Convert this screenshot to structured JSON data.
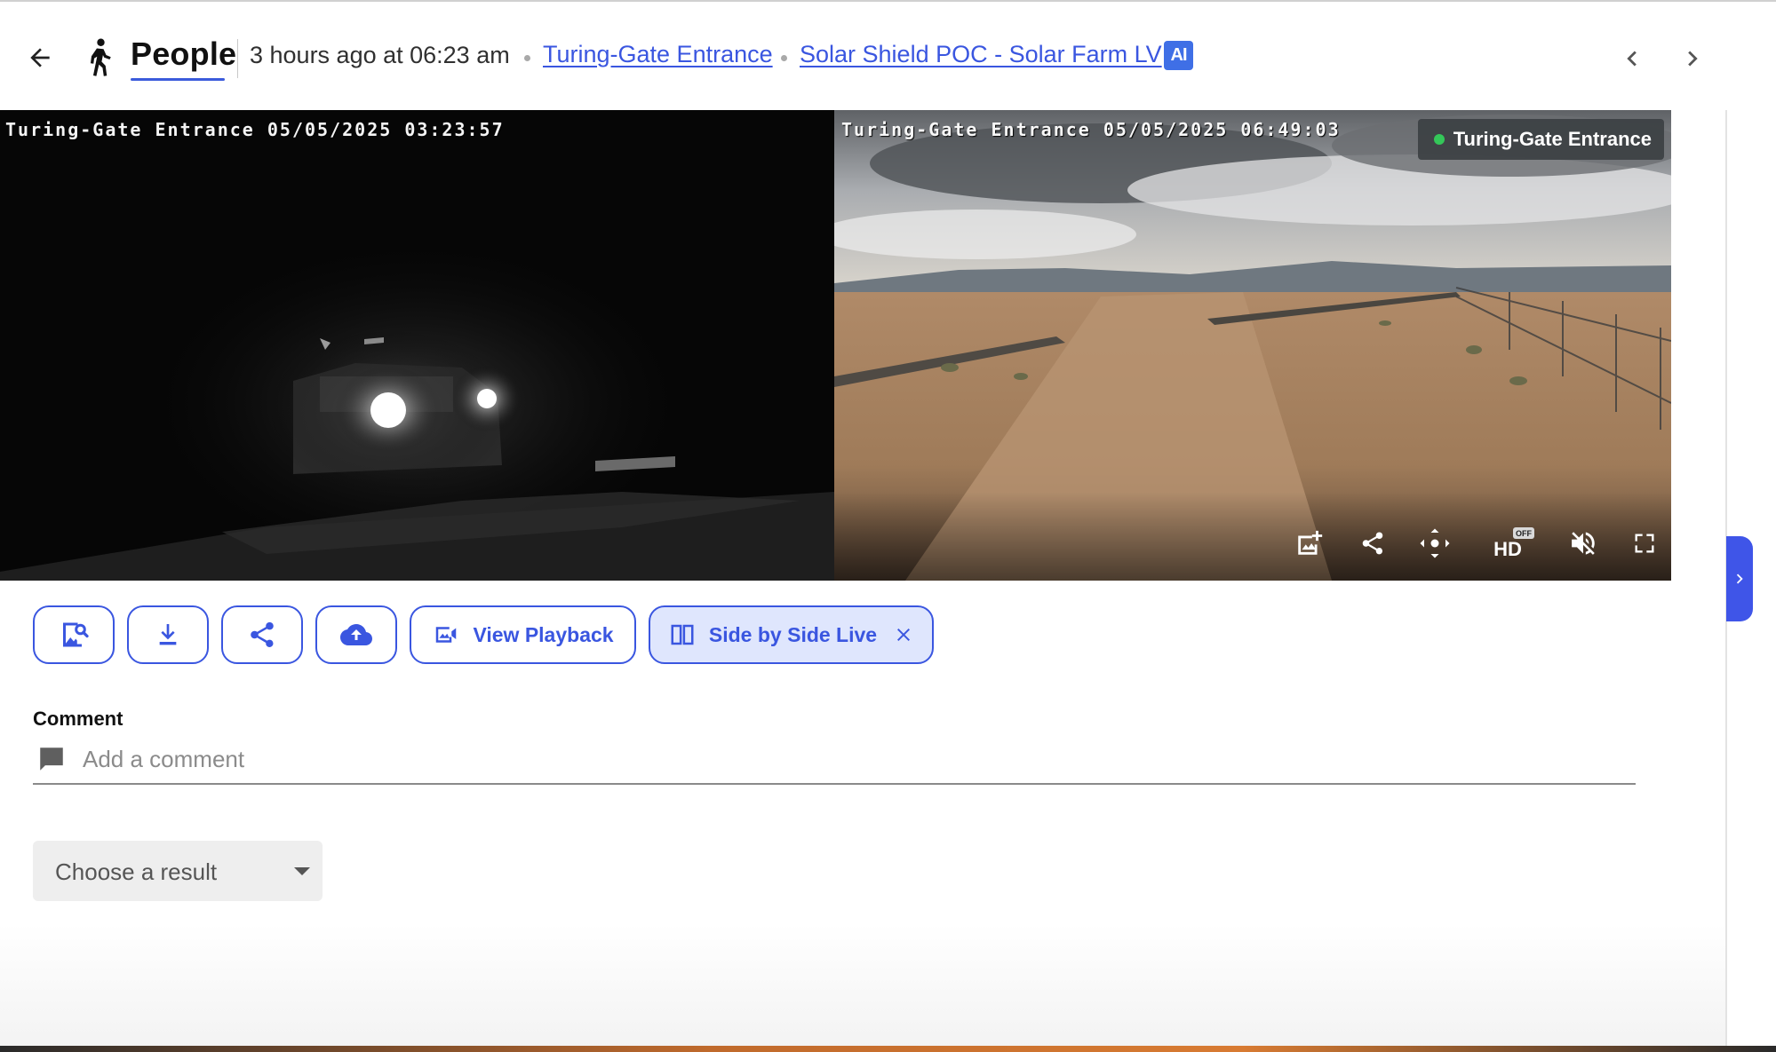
{
  "header": {
    "title": "People",
    "time_text": "3 hours ago at 06:23 am",
    "breadcrumbs": [
      "Turing-Gate Entrance",
      "Solar Shield POC - Solar Farm LV"
    ],
    "ai_badge": "AI",
    "icons": {
      "back": "arrow-left-icon",
      "category": "person-walking-icon",
      "prev": "chevron-left-icon",
      "next": "chevron-right-icon"
    }
  },
  "video": {
    "left_timestamp": "Turing-Gate Entrance 05/05/2025 03:23:57",
    "right_timestamp": "Turing-Gate Entrance 05/05/2025 06:49:03",
    "live_camera_label": "Turing-Gate Entrance",
    "hd_badge": "HD",
    "hd_state": "OFF",
    "controls": [
      "snapshot-icon",
      "share-icon",
      "ptz-move-icon",
      "hd-toggle-icon",
      "volume-off-icon",
      "fullscreen-icon"
    ]
  },
  "actions": {
    "icon_buttons": [
      "image-search-icon",
      "download-icon",
      "share-icon",
      "cloud-upload-icon"
    ],
    "view_playback": "View Playback",
    "side_by_side": "Side by Side Live"
  },
  "comment": {
    "label": "Comment",
    "placeholder": "Add a comment",
    "value": ""
  },
  "result": {
    "placeholder": "Choose a result"
  },
  "colors": {
    "accent": "#3a56e0",
    "accent_soft": "#dfe6fd",
    "ai_badge": "#3f6fe6",
    "live_dot": "#34c759",
    "side_tab": "#3f55e8"
  }
}
